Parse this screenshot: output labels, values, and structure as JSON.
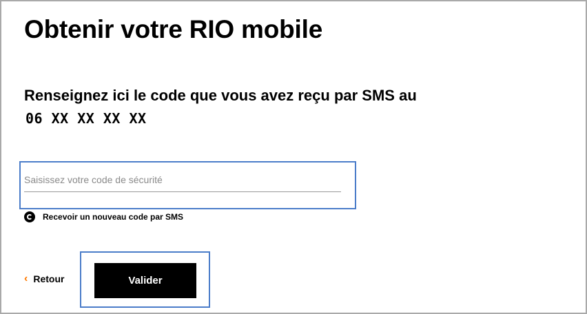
{
  "page": {
    "title": "Obtenir votre RIO mobile",
    "instruction": "Renseignez ici le code que vous avez reçu par SMS au",
    "phone_number": "06 XX XX XX XX"
  },
  "form": {
    "code_placeholder": "Saisissez votre code de sécurité",
    "code_value": "",
    "resend_label": "Recevoir un nouveau code par SMS",
    "resend_icon": "refresh-icon"
  },
  "actions": {
    "back_label": "Retour",
    "back_icon": "chevron-left-icon",
    "validate_label": "Valider"
  },
  "colors": {
    "accent": "#ff7900",
    "button_bg": "#000000",
    "highlight": "#4a7cc9"
  }
}
